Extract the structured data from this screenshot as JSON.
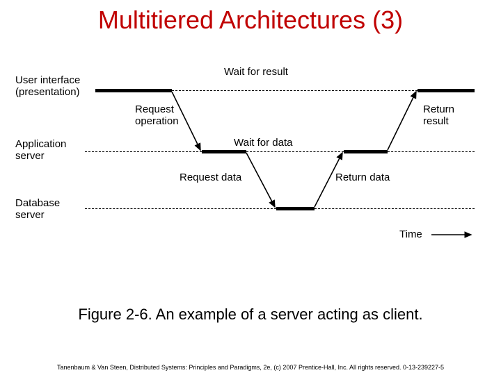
{
  "title": "Multitiered Architectures (3)",
  "caption": "Figure 2-6. An example of a server acting as client.",
  "footer": "Tanenbaum & Van Steen, Distributed Systems: Principles and Paradigms, 2e, (c) 2007 Prentice-Hall, Inc. All rights reserved. 0-13-239227-5",
  "layers": {
    "ui_line1": "User interface",
    "ui_line2": "(presentation)",
    "app": "Application",
    "app_line2": "server",
    "db": "Database",
    "db_line2": "server"
  },
  "labels": {
    "wait_result": "Wait for result",
    "request_op": "Request",
    "request_op2": "operation",
    "wait_data": "Wait for data",
    "request_data": "Request data",
    "return_data": "Return data",
    "return_result": "Return",
    "return_result2": "result",
    "time": "Time"
  },
  "chart_data": {
    "type": "sequence-diagram",
    "tiers": [
      "User interface (presentation)",
      "Application server",
      "Database server"
    ],
    "flow": [
      {
        "from": "User interface",
        "to": "Application server",
        "label": "Request operation"
      },
      {
        "from": "Application server",
        "to": "Database server",
        "label": "Request data"
      },
      {
        "from": "Database server",
        "to": "Application server",
        "label": "Return data"
      },
      {
        "from": "Application server",
        "to": "User interface",
        "label": "Return result"
      }
    ],
    "waits": [
      {
        "tier": "User interface",
        "label": "Wait for result"
      },
      {
        "tier": "Application server",
        "label": "Wait for data"
      }
    ],
    "time_axis": "left-to-right"
  }
}
